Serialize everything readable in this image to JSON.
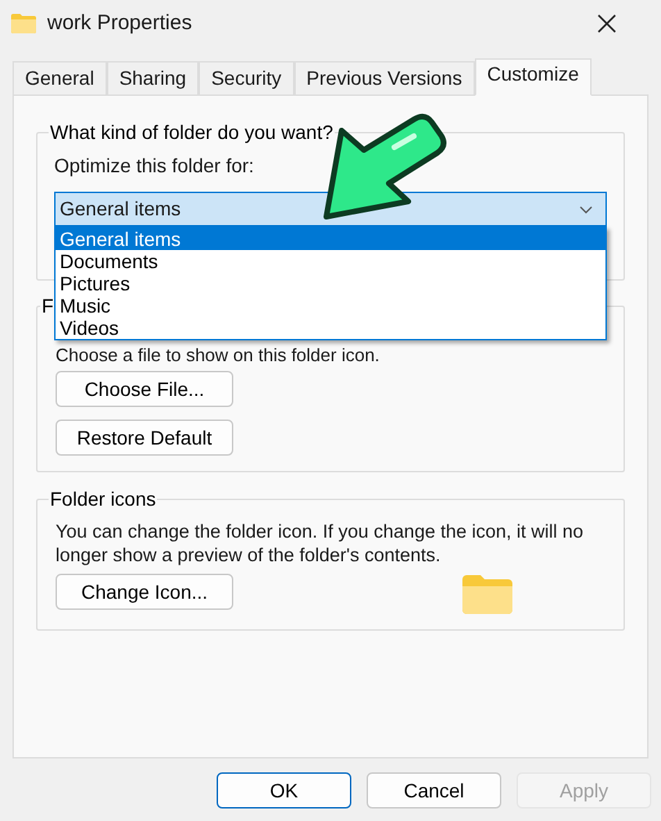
{
  "window": {
    "title": "work Properties"
  },
  "tabs": [
    {
      "label": "General",
      "selected": false
    },
    {
      "label": "Sharing",
      "selected": false
    },
    {
      "label": "Security",
      "selected": false
    },
    {
      "label": "Previous Versions",
      "selected": false
    },
    {
      "label": "Customize",
      "selected": true
    }
  ],
  "folder_type": {
    "title": "What kind of folder do you want?",
    "label": "Optimize this folder for:",
    "value": "General items",
    "expanded": true,
    "options": [
      {
        "label": "General items",
        "selected": true
      },
      {
        "label": "Documents",
        "selected": false
      },
      {
        "label": "Pictures",
        "selected": false
      },
      {
        "label": "Music",
        "selected": false
      },
      {
        "label": "Videos",
        "selected": false
      }
    ]
  },
  "folder_pictures": {
    "title": "F",
    "text": "Choose a file to show on this folder icon.",
    "buttons": [
      "Choose File...",
      "Restore Default"
    ]
  },
  "folder_icons": {
    "title": "Folder icons",
    "text": "You can change the folder icon. If you change the icon, it will no longer show a preview of the folder's contents.",
    "button": "Change Icon..."
  },
  "buttons": [
    {
      "label": "OK",
      "default": true,
      "disabled": false
    },
    {
      "label": "Cancel",
      "default": false,
      "disabled": false
    },
    {
      "label": "Apply",
      "default": false,
      "disabled": true
    }
  ]
}
